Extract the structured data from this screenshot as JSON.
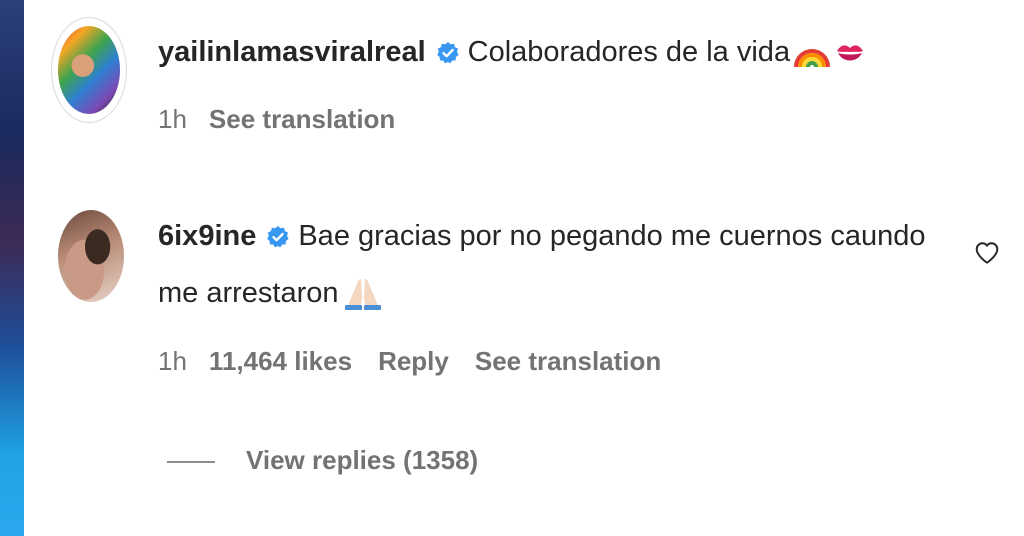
{
  "comments": [
    {
      "username": "yailinlamasviralreal",
      "text": "Colaboradores de la vida",
      "emojis": [
        "rainbow-emoji",
        "kiss-mark-emoji"
      ],
      "time": "1h",
      "actions": {
        "translate": "See translation"
      }
    },
    {
      "username": "6ix9ine",
      "text_line1": "Bae gracias por no pegando me cuernos caundo",
      "text_line2": "me arrestaron",
      "emojis": [
        "folded-hands-emoji"
      ],
      "time": "1h",
      "likes": "11,464 likes",
      "actions": {
        "reply": "Reply",
        "translate": "See translation"
      },
      "view_replies": "View replies (1358)"
    }
  ],
  "colors": {
    "verified": "#3897f0",
    "text": "#262626",
    "meta": "#737373"
  }
}
